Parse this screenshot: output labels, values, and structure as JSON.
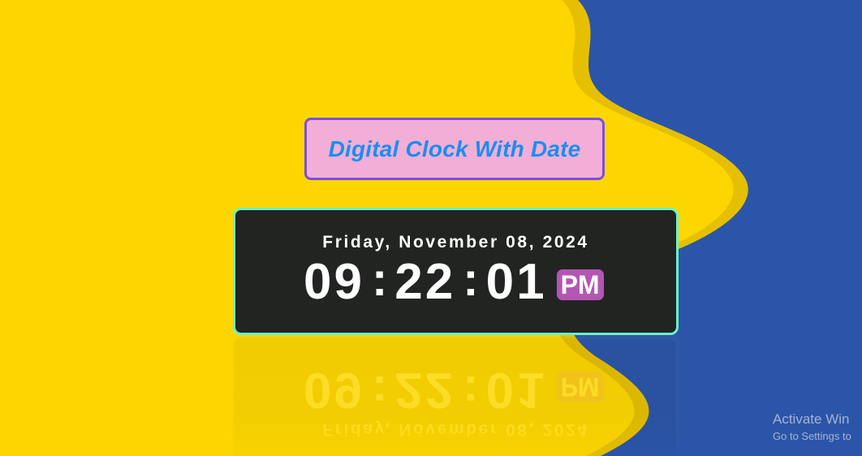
{
  "title": "Digital Clock With Date",
  "clock": {
    "date": "Friday, November 08, 2024",
    "hours": "09",
    "minutes": "22",
    "seconds": "01",
    "separator": ":",
    "period": "PM"
  },
  "watermark": {
    "line1": "Activate Win",
    "line2": "Go to Settings to"
  },
  "colors": {
    "background_yellow": "#fdd600",
    "background_blue": "#2b55a8",
    "title_bg": "#f2aed6",
    "title_border": "#7b4fe0",
    "title_text": "#1a8ef0",
    "clock_bg": "#222422",
    "clock_border": "#6bf2c8",
    "period_bg": "#b456b4"
  }
}
